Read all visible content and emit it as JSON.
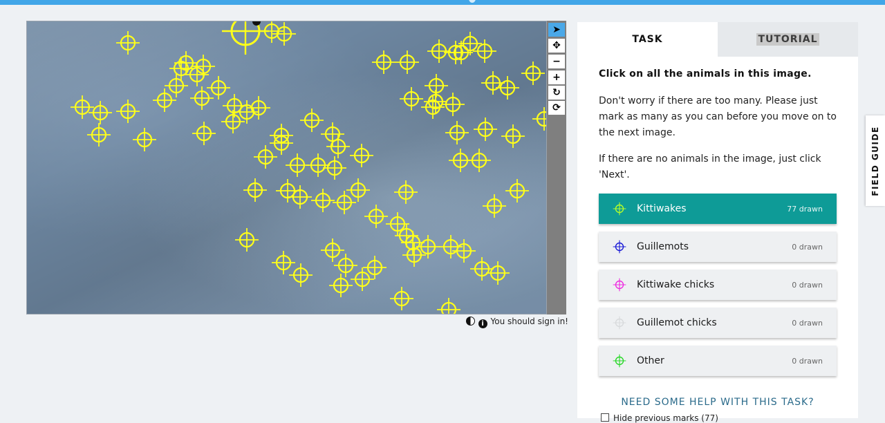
{
  "viewer": {
    "tools": [
      {
        "icon": "pointer-icon",
        "glyph": "➤",
        "name": "annotate-tool-button",
        "active": true
      },
      {
        "icon": "move-icon",
        "glyph": "✥",
        "name": "move-tool-button"
      },
      {
        "icon": "zoom-out-icon",
        "glyph": "−",
        "name": "zoom-out-button"
      },
      {
        "icon": "zoom-in-icon",
        "glyph": "+",
        "name": "zoom-in-button"
      },
      {
        "icon": "rotate-icon",
        "glyph": "↻",
        "name": "rotate-button"
      },
      {
        "icon": "reset-icon",
        "glyph": "⟳",
        "name": "reset-view-button"
      }
    ],
    "marker_color": "#ffff1a",
    "footer_text": "You should sign in!",
    "info_glyph": "i"
  },
  "task": {
    "tab_task": "TASK",
    "tab_tutorial": "TUTORIAL",
    "question": "Click on all the animals in this image.",
    "instructions": [
      "Don't worry if there are too many. Please just mark as many as you can before you move on to the next image.",
      "If there are no animals in the image, just click 'Next'."
    ],
    "choices": [
      {
        "label": "Kittiwakes",
        "count": "77 drawn",
        "color": "#b5ff2a",
        "selected": true
      },
      {
        "label": "Guillemots",
        "count": "0 drawn",
        "color": "#1a1ad6",
        "selected": false
      },
      {
        "label": "Kittiwake chicks",
        "count": "0 drawn",
        "color": "#ee2ce0",
        "selected": false
      },
      {
        "label": "Guillemot chicks",
        "count": "0 drawn",
        "color": "#d8dadc",
        "selected": false
      },
      {
        "label": "Other",
        "count": "0 drawn",
        "color": "#29d829",
        "selected": false
      }
    ],
    "help_text": "NEED SOME HELP WITH THIS TASK?",
    "hide_marks_label": "Hide previous marks (77)"
  },
  "field_guide": "FIELD GUIDE",
  "colors": {
    "accent": "#0e9b97",
    "topbar": "#41a6e8"
  }
}
